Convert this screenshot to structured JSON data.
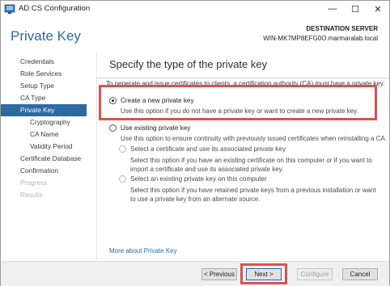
{
  "window": {
    "title": "AD CS Configuration",
    "controls": {
      "minimize": "—",
      "maximize": "☐",
      "close": "✕"
    }
  },
  "header": {
    "page_title": "Private Key",
    "destination_label": "DESTINATION SERVER",
    "destination_server": "WIN-MK7MP8EFG0O.marmaralab.local"
  },
  "sidebar": {
    "items": [
      {
        "label": "Credentials",
        "state": "normal",
        "level": 0
      },
      {
        "label": "Role Services",
        "state": "normal",
        "level": 0
      },
      {
        "label": "Setup Type",
        "state": "normal",
        "level": 0
      },
      {
        "label": "CA Type",
        "state": "normal",
        "level": 0
      },
      {
        "label": "Private Key",
        "state": "active",
        "level": 0
      },
      {
        "label": "Cryptography",
        "state": "normal",
        "level": 1
      },
      {
        "label": "CA Name",
        "state": "normal",
        "level": 1
      },
      {
        "label": "Validity Period",
        "state": "normal",
        "level": 1
      },
      {
        "label": "Certificate Database",
        "state": "normal",
        "level": 0
      },
      {
        "label": "Confirmation",
        "state": "normal",
        "level": 0
      },
      {
        "label": "Progress",
        "state": "disabled",
        "level": 0
      },
      {
        "label": "Results",
        "state": "disabled",
        "level": 0
      }
    ]
  },
  "main": {
    "section_title": "Specify the type of the private key",
    "intro": "To generate and issue certificates to clients, a certification authority (CA) must have a private key.",
    "options": {
      "create_new": {
        "label": "Create a new private key",
        "description": "Use this option if you do not have a private key or want to create a new private key.",
        "checked": true
      },
      "use_existing": {
        "label": "Use existing private key",
        "description": "Use this option to ensure continuity with previously issued certificates when reinstalling a CA.",
        "checked": false
      },
      "select_certificate": {
        "label": "Select a certificate and use its associated private key",
        "description": "Select this option if you have an existing certificate on this computer or if you want to import a certificate and use its associated private key.",
        "checked": false
      },
      "select_existing_key": {
        "label": "Select an existing private key on this computer",
        "description": "Select this option if you have retained private keys from a previous installation or want to use a private key from an alternate source.",
        "checked": false
      }
    },
    "more_link": "More about Private Key"
  },
  "footer": {
    "previous_label": "< Previous",
    "next_label": "Next >",
    "configure_label": "Configure",
    "cancel_label": "Cancel"
  },
  "colors": {
    "accent": "#2b6aa6",
    "highlight": "#d9534f"
  }
}
